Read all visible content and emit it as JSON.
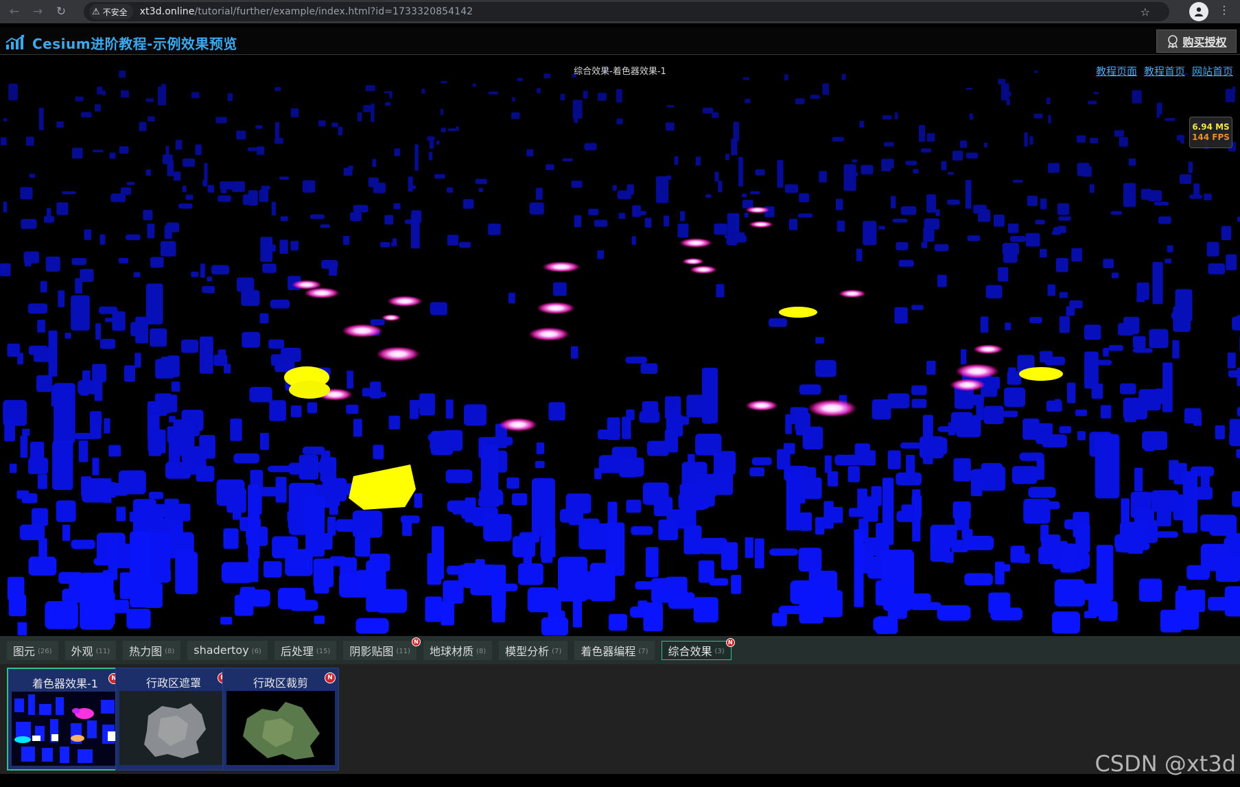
{
  "browser": {
    "security_label": "不安全",
    "url_host": "xt3d.online",
    "url_path": "/tutorial/further/example/index.html?id=1733320854142"
  },
  "header": {
    "title": "Cesium进阶教程-示例效果预览",
    "buy_label": "购买授权"
  },
  "scene": {
    "title": "综合效果-着色器效果-1",
    "links": [
      "教程页面",
      "教程首页",
      "网站首页"
    ],
    "stats": {
      "ms": "6.94 MS",
      "fps": "144 FPS"
    }
  },
  "tabs": [
    {
      "label": "图元",
      "count": "(26)",
      "is_new": false,
      "active": false
    },
    {
      "label": "外观",
      "count": "(11)",
      "is_new": false,
      "active": false
    },
    {
      "label": "热力图",
      "count": "(8)",
      "is_new": false,
      "active": false
    },
    {
      "label": "shadertoy",
      "count": "(6)",
      "is_new": false,
      "active": false
    },
    {
      "label": "后处理",
      "count": "(15)",
      "is_new": false,
      "active": false
    },
    {
      "label": "阴影贴图",
      "count": "(11)",
      "is_new": true,
      "active": false
    },
    {
      "label": "地球材质",
      "count": "(8)",
      "is_new": false,
      "active": false
    },
    {
      "label": "模型分析",
      "count": "(7)",
      "is_new": false,
      "active": false
    },
    {
      "label": "着色器编程",
      "count": "(7)",
      "is_new": false,
      "active": false
    },
    {
      "label": "综合效果",
      "count": "(3)",
      "is_new": true,
      "active": true
    }
  ],
  "badge_text": "N",
  "cards": [
    {
      "title": "着色器效果-1",
      "active": true
    },
    {
      "title": "行政区遮罩",
      "active": false
    },
    {
      "title": "行政区裁剪",
      "active": false
    }
  ],
  "watermark": "CSDN @xt3d"
}
